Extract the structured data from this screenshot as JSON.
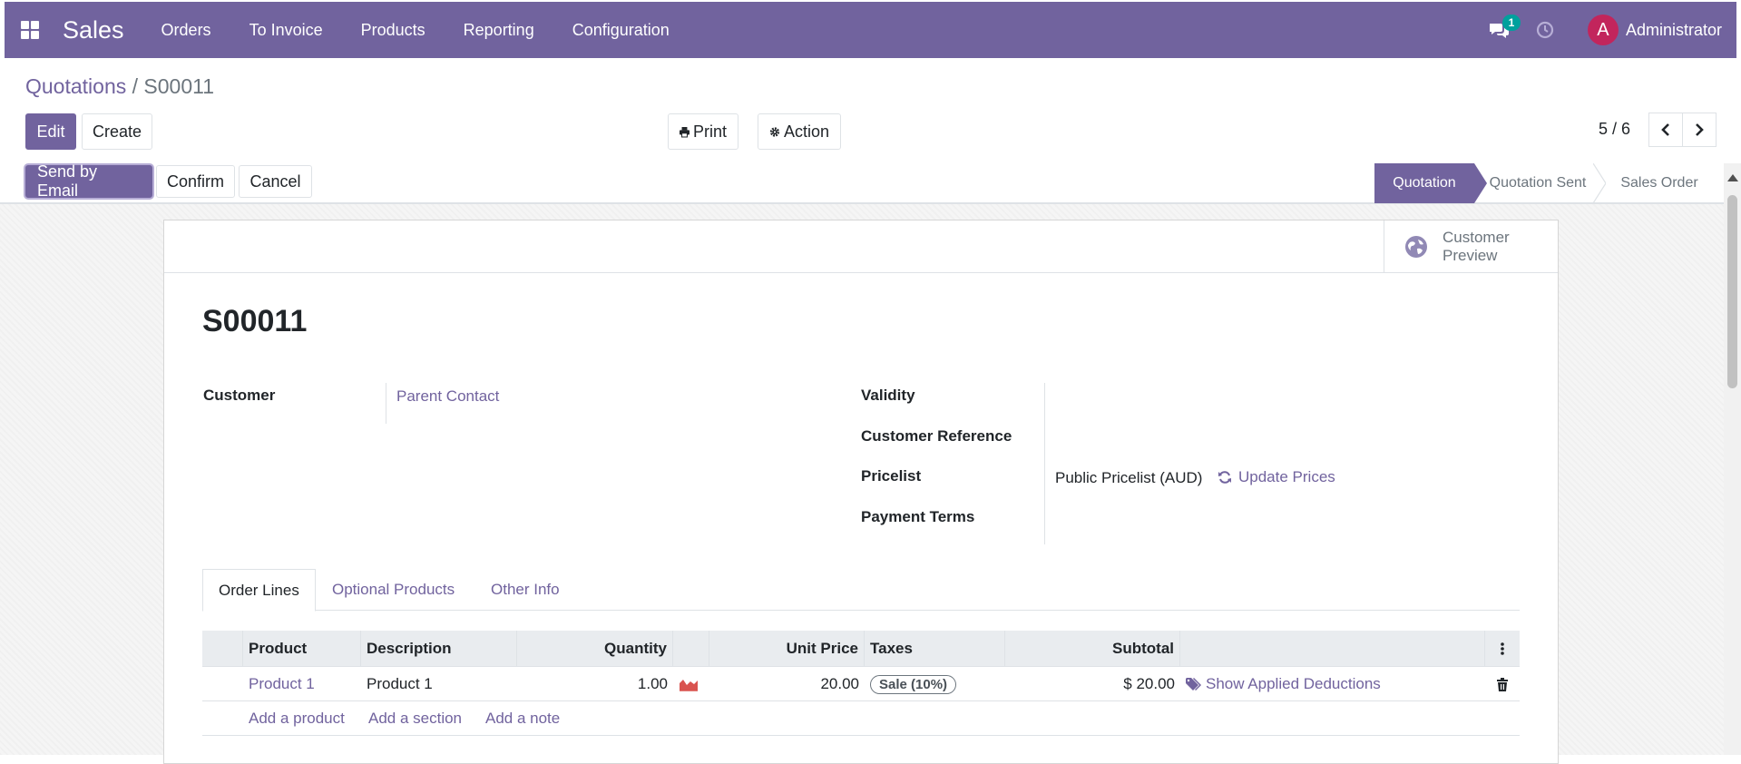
{
  "navbar": {
    "app_name": "Sales",
    "menu": [
      "Orders",
      "To Invoice",
      "Products",
      "Reporting",
      "Configuration"
    ],
    "message_count": "1",
    "user_initial": "A",
    "user_name": "Administrator"
  },
  "breadcrumb": {
    "parent": "Quotations",
    "separator": " / ",
    "current": "S00011"
  },
  "toolbar": {
    "edit": "Edit",
    "create": "Create",
    "print": "Print",
    "action": "Action"
  },
  "pager": {
    "value": "5 / 6"
  },
  "status_actions": {
    "send_email": "Send by Email",
    "confirm": "Confirm",
    "cancel": "Cancel"
  },
  "stages": [
    "Quotation",
    "Quotation Sent",
    "Sales Order"
  ],
  "active_stage": "Quotation",
  "customer_preview": {
    "line1": "Customer",
    "line2": "Preview"
  },
  "record": {
    "name": "S00011",
    "labels": {
      "customer": "Customer",
      "validity": "Validity",
      "customer_reference": "Customer Reference",
      "pricelist": "Pricelist",
      "payment_terms": "Payment Terms"
    },
    "customer": "Parent Contact",
    "pricelist": "Public Pricelist (AUD)",
    "update_prices": "Update Prices"
  },
  "tabs": [
    "Order Lines",
    "Optional Products",
    "Other Info"
  ],
  "order_lines": {
    "columns": [
      "Product",
      "Description",
      "Quantity",
      "Unit Price",
      "Taxes",
      "Subtotal"
    ],
    "rows": [
      {
        "product": "Product 1",
        "description": "Product 1",
        "quantity": "1.00",
        "unit_price": "20.00",
        "taxes": "Sale (10%)",
        "subtotal": "$ 20.00",
        "deductions": "Show Applied Deductions"
      }
    ],
    "add_links": [
      "Add a product",
      "Add a section",
      "Add a note"
    ]
  },
  "colors": {
    "brand": "#71639e",
    "badge": "#00a09d",
    "avatar": "#c2255c",
    "forecast_icon": "#d9534f"
  }
}
